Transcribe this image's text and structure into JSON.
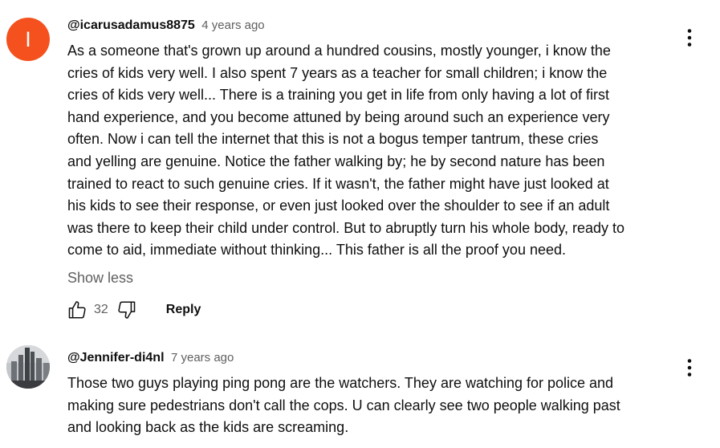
{
  "comments": [
    {
      "avatar_letter": "I",
      "avatar_color": "#f4511e",
      "author": "@icarusadamus8875",
      "time": "4 years ago",
      "lines": [
        "As a someone that's grown up around a hundred cousins, mostly younger, i know the",
        "cries of kids very well. I also spent 7 years as a teacher for small children; i know the",
        "cries of kids very well... There is a training you get in life from only having a lot of first",
        "hand experience, and you become attuned by being around such an experience very",
        "often. Now i can tell the internet that this is not a bogus temper tantrum, these cries",
        "and yelling are genuine. Notice the father walking by; he by second nature has been",
        "trained to react to such genuine cries. If it wasn't, the father might have just looked at",
        "his kids to see their response, or even just looked over the shoulder to see if an adult",
        "was there to keep their child under control. But to abruptly turn his whole body, ready to",
        "come to aid, immediate without thinking... This father is all the proof you need."
      ],
      "show_less_label": "Show less",
      "like_count": "32",
      "reply_label": "Reply",
      "icons": {
        "like": "thumbs-up-icon",
        "dislike": "thumbs-down-icon",
        "menu": "more-vertical-icon"
      }
    },
    {
      "avatar_color": "#b9bcc0",
      "author": "@Jennifer-di4nl",
      "time": "7 years ago",
      "lines": [
        "Those two guys playing ping pong are the watchers. They are watching for police and",
        "making sure pedestrians don't call the cops. U can clearly see two people walking past",
        "and looking back as the kids are screaming."
      ],
      "icons": {
        "menu": "more-vertical-icon"
      }
    }
  ]
}
